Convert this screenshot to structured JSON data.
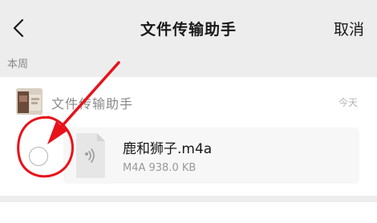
{
  "header": {
    "title": "文件传输助手",
    "cancel_label": "取消"
  },
  "section_label": "本周",
  "message": {
    "sender": "文件传输助手",
    "time": "今天",
    "file": {
      "name": "鹿和狮子.m4a",
      "meta": "M4A 938.0 KB",
      "icon": "audio-file-icon"
    }
  },
  "colors": {
    "background": "#ededed",
    "annotation_red": "#e8111a"
  }
}
